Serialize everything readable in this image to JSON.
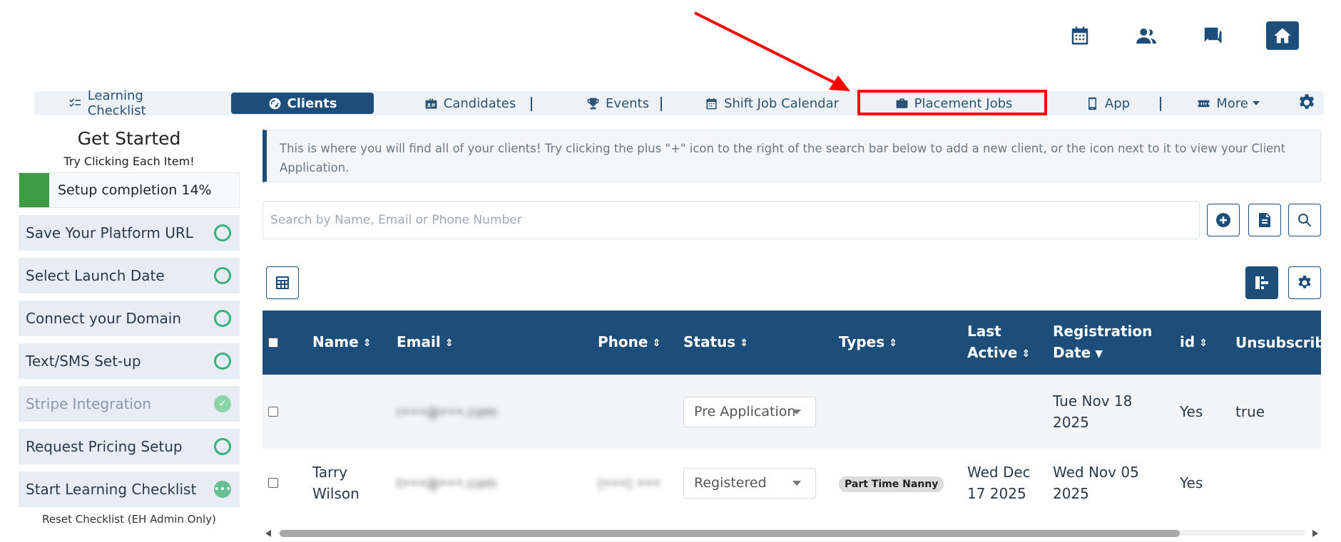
{
  "topbar": {
    "icons": [
      "calendar-icon",
      "users-icon",
      "chat-icon",
      "home-icon"
    ]
  },
  "nav": {
    "items": [
      {
        "label": "Learning Checklist",
        "icon": "checklist-icon"
      },
      {
        "label": "Clients",
        "icon": "globe-icon",
        "active": true
      },
      {
        "label": "Candidates",
        "icon": "id-badge-icon"
      },
      {
        "label": "Events",
        "icon": "trophy-icon"
      },
      {
        "label": "Shift Job Calendar",
        "icon": "calendar-icon"
      },
      {
        "label": "Placement Jobs",
        "icon": "briefcase-icon"
      },
      {
        "label": "App",
        "icon": "mobile-icon"
      },
      {
        "label": "More",
        "icon": "ticket-icon"
      }
    ]
  },
  "sidebar": {
    "title": "Get Started",
    "subtitle": "Try Clicking Each Item!",
    "progress_label": "Setup completion 14%",
    "progress_value": 0.14,
    "steps": [
      {
        "label": "Save Your Platform URL",
        "status": "pending"
      },
      {
        "label": "Select Launch Date",
        "status": "pending"
      },
      {
        "label": "Connect your Domain",
        "status": "pending"
      },
      {
        "label": "Text/SMS Set-up",
        "status": "pending"
      },
      {
        "label": "Stripe Integration",
        "status": "done"
      },
      {
        "label": "Request Pricing Setup",
        "status": "pending"
      },
      {
        "label": "Start Learning Checklist",
        "status": "in-progress"
      }
    ],
    "reset_label": "Reset Checklist (EH Admin Only)"
  },
  "info": {
    "text": "This is where you will find all of your clients! Try clicking the plus \"+\" icon to the right of the search bar below to add a new client, or the icon next to it to view your Client Application."
  },
  "search": {
    "placeholder": "Search by Name, Email or Phone Number"
  },
  "table": {
    "headers": {
      "name": "Name",
      "email": "Email",
      "phone": "Phone",
      "status": "Status",
      "types": "Types",
      "last_active": "Last Active",
      "registration_date": "Registration Date",
      "id": "id",
      "unsubscribed": "Unsubscribed"
    },
    "rows": [
      {
        "name": "",
        "email": "r•••@•••.com",
        "phone": "",
        "status": "Pre Application",
        "types": "",
        "last_active": "",
        "registration_date": "Tue Nov 18 2025",
        "id": "Yes",
        "unsubscribed": "true"
      },
      {
        "name": "Tarry Wilson",
        "email": "t•••@•••.com",
        "phone": "(•••) •••",
        "status": "Registered",
        "types": "Part Time Nanny",
        "last_active": "Wed Dec 17 2025",
        "registration_date": "Wed Nov 05 2025",
        "id": "Yes",
        "unsubscribed": ""
      }
    ]
  },
  "colors": {
    "primary": "#1d4e79",
    "success": "#3d9a45",
    "highlight": "#ff0000"
  }
}
